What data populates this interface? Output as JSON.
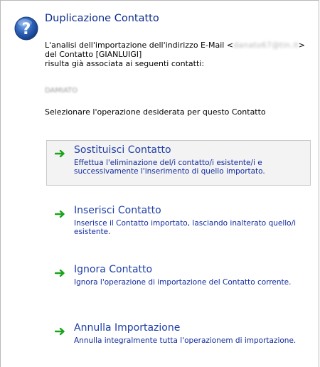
{
  "dialog": {
    "title": "Duplicazione Contatto",
    "icon": "help-icon",
    "message_line1_prefix": "L'analisi dell'importazione dell'indirizzo E-Mail <",
    "message_email_redacted": "danato67@tin.it",
    "message_line1_suffix": ">",
    "message_line2": "del Contatto [GIANLUIGI]",
    "message_line3": "risulta già associata ai seguenti contatti:",
    "existing_contact_redacted": "DAMIATO",
    "prompt": "Selezionare l'operazione desiderata per questo Contatto"
  },
  "options": [
    {
      "title": "Sostituisci Contatto",
      "description": "Effettua l'eliminazione del/i contatto/i esistente/i e successivamente l'inserimento di quello importato.",
      "icon": "green-arrow-icon",
      "selected": true
    },
    {
      "title": "Inserisci Contatto",
      "description": "Inserisce il Contatto importato, lasciando inalterato quello/i esistente.",
      "icon": "green-arrow-icon",
      "selected": false
    },
    {
      "title": "Ignora Contatto",
      "description": "Ignora l'operazione di importazione del Contatto corrente.",
      "icon": "green-arrow-icon",
      "selected": false
    },
    {
      "title": "Annulla Importazione",
      "description": "Annulla integralmente tutta l'operazionem di importazione.",
      "icon": "green-arrow-icon",
      "selected": false
    }
  ],
  "colors": {
    "title": "#0a2a8a",
    "option_title": "#1f3fa8",
    "option_desc": "#102a9c",
    "arrow": "#1aa31a",
    "selected_bg": "#f3f3f3",
    "selected_border": "#c9c9c9",
    "icon_blue": "#2e63b8"
  }
}
